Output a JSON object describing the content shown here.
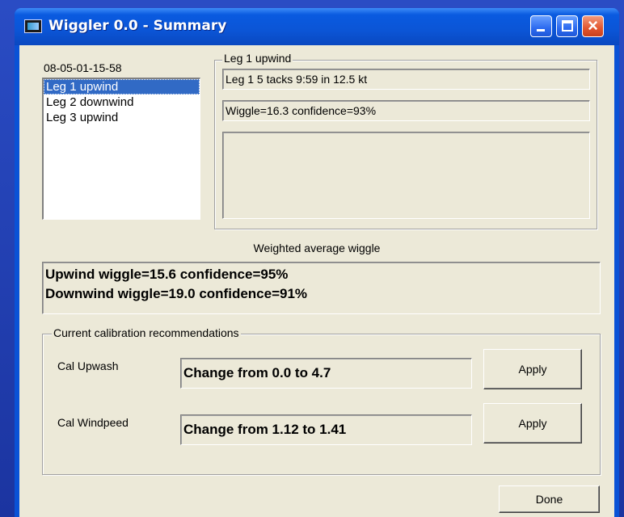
{
  "window": {
    "title": "Wiggler 0.0 - Summary"
  },
  "session_id": "08-05-01-15-58",
  "legs": [
    "Leg 1 upwind",
    "Leg 2 downwind",
    "Leg 3 upwind"
  ],
  "selected_leg_index": 0,
  "leg_detail": {
    "group_title": "Leg 1 upwind",
    "summary": "Leg 1 5 tacks 9:59 in 12.5 kt",
    "wiggle": "Wiggle=16.3 confidence=93%",
    "notes": ""
  },
  "weighted": {
    "label": "Weighted average wiggle",
    "upwind": "Upwind wiggle=15.6 confidence=95%",
    "downwind": "Downwind wiggle=19.0 confidence=91%"
  },
  "calibration": {
    "group_title": "Current calibration recommendations",
    "rows": [
      {
        "label": "Cal Upwash",
        "value": "Change from 0.0 to 4.7",
        "button": "Apply"
      },
      {
        "label": "Cal Windpeed",
        "value": "Change from 1.12 to 1.41",
        "button": "Apply"
      }
    ]
  },
  "done_button": "Done"
}
